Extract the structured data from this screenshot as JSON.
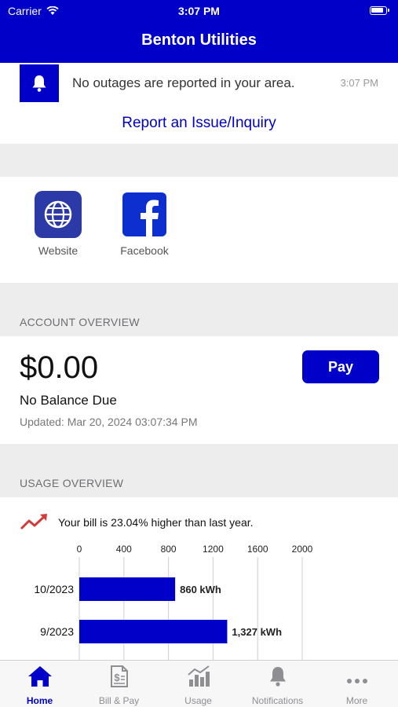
{
  "status_bar": {
    "carrier": "Carrier",
    "time": "3:07 PM"
  },
  "nav": {
    "title": "Benton Utilities"
  },
  "outage": {
    "message": "No outages are reported in your area.",
    "time": "3:07 PM",
    "report_link": "Report an Issue/Inquiry"
  },
  "social": {
    "items": [
      {
        "label": "Website"
      },
      {
        "label": "Facebook"
      }
    ]
  },
  "account_overview": {
    "header": "ACCOUNT OVERVIEW",
    "amount": "$0.00",
    "status": "No Balance Due",
    "updated": "Updated: Mar 20, 2024 03:07:34 PM",
    "pay_label": "Pay"
  },
  "usage_overview": {
    "header": "USAGE OVERVIEW",
    "trend_text": "Your bill is 23.04% higher than last year."
  },
  "chart_data": {
    "type": "bar",
    "orientation": "horizontal",
    "categories": [
      "10/2023",
      "9/2023"
    ],
    "values": [
      860,
      1327
    ],
    "value_labels": [
      "860 kWh",
      "1,327 kWh"
    ],
    "xlim": [
      0,
      2000
    ],
    "xticks": [
      0,
      400,
      800,
      1200,
      1600,
      2000
    ],
    "grid": true,
    "bar_color": "#0000c8"
  },
  "tabs": [
    {
      "label": "Home",
      "icon": "home-icon",
      "active": true
    },
    {
      "label": "Bill & Pay",
      "icon": "bill-icon",
      "active": false
    },
    {
      "label": "Usage",
      "icon": "usage-chart-icon",
      "active": false
    },
    {
      "label": "Notifications",
      "icon": "bell-icon",
      "active": false
    },
    {
      "label": "More",
      "icon": "more-icon",
      "active": false
    }
  ],
  "colors": {
    "brand": "#0000c8",
    "background": "#ededed",
    "muted": "#6d6d72",
    "trend": "#d33a3a"
  }
}
